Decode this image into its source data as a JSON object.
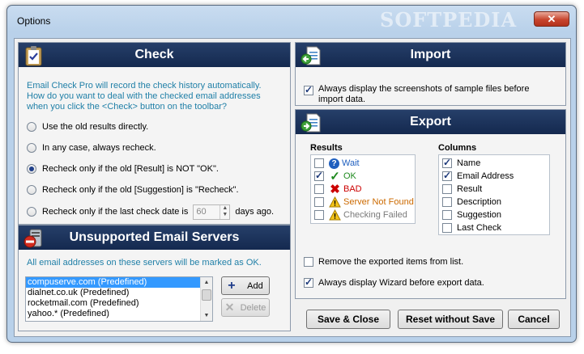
{
  "window": {
    "title": "Options",
    "close_glyph": "✕",
    "watermark": "SOFTPEDIA"
  },
  "check": {
    "header": "Check",
    "icon": "clipboard-check-icon",
    "description": [
      "Email Check Pro will record the check history automatically.",
      "How do you want to deal with the checked email addresses",
      "when you click the <Check> button on the toolbar?"
    ],
    "options": [
      {
        "label": "Use the old results directly.",
        "selected": false
      },
      {
        "label": "In any case, always recheck.",
        "selected": false
      },
      {
        "label": "Recheck only if the old [Result] is NOT \"OK\".",
        "selected": true
      },
      {
        "label": "Recheck only if the old [Suggestion] is \"Recheck\".",
        "selected": false
      }
    ],
    "last_date_option": {
      "prefix": "Recheck only if the last check date is",
      "days_value": "60",
      "suffix": "days ago.",
      "selected": false
    }
  },
  "unsupported": {
    "header": "Unsupported Email Servers",
    "icon": "server-forbidden-icon",
    "description": "All email addresses on these servers will be marked as OK.",
    "servers": [
      "compuserve.com (Predefined)",
      "dialnet.co.uk (Predefined)",
      "rocketmail.com (Predefined)",
      "yahoo.* (Predefined)"
    ],
    "selected_index": 0,
    "add_label": "Add",
    "delete_label": "Delete"
  },
  "import": {
    "header": "Import",
    "icon": "import-document-icon",
    "screenshots_label": [
      "Always display the screenshots of sample files before",
      "import data."
    ],
    "screenshots_checked": true
  },
  "export": {
    "header": "Export",
    "icon": "export-document-icon",
    "results_title": "Results",
    "results": [
      {
        "label": "Wait",
        "icon": "question-icon",
        "color": "#1f5fbf",
        "checked": false
      },
      {
        "label": "OK",
        "icon": "checkmark-icon",
        "color": "#1f8a1f",
        "checked": true
      },
      {
        "label": "BAD",
        "icon": "red-x-icon",
        "color": "#cc0000",
        "checked": false
      },
      {
        "label": "Server Not Found",
        "icon": "warning-icon",
        "color": "#cc6a00",
        "checked": false
      },
      {
        "label": "Checking Failed",
        "icon": "warning-icon",
        "color": "#7a7a7a",
        "checked": false
      }
    ],
    "columns_title": "Columns",
    "columns": [
      {
        "label": "Name",
        "checked": true
      },
      {
        "label": "Email Address",
        "checked": true
      },
      {
        "label": "Result",
        "checked": false
      },
      {
        "label": "Description",
        "checked": false
      },
      {
        "label": "Suggestion",
        "checked": false
      },
      {
        "label": "Last Check",
        "checked": false
      }
    ],
    "remove_label": "Remove the exported items from list.",
    "remove_checked": false,
    "wizard_label": "Always display Wizard before export data.",
    "wizard_checked": true
  },
  "buttons": {
    "save_close": "Save & Close",
    "reset": "Reset without Save",
    "cancel": "Cancel"
  },
  "colors": {
    "header_bg": "#1b3158",
    "accent_text": "#1f7fa7",
    "selection": "#3399ff"
  }
}
